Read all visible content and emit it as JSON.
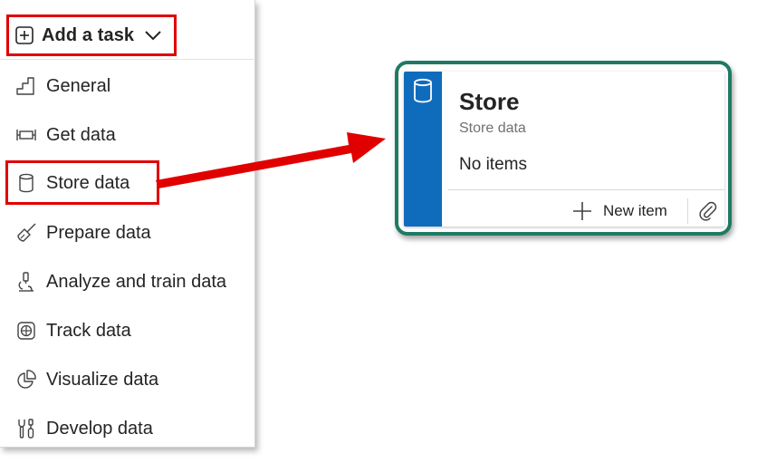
{
  "menu": {
    "add_task": {
      "label": "Add a task",
      "icon": "add-square-icon",
      "chevron": "chevron-down-icon"
    },
    "items": [
      {
        "label": "General",
        "icon": "stairs-icon"
      },
      {
        "label": "Get data",
        "icon": "get-data-icon"
      },
      {
        "label": "Store data",
        "icon": "database-icon"
      },
      {
        "label": "Prepare data",
        "icon": "broom-icon"
      },
      {
        "label": "Analyze and train data",
        "icon": "microscope-icon"
      },
      {
        "label": "Track data",
        "icon": "grid-globe-icon"
      },
      {
        "label": "Visualize data",
        "icon": "pie-chart-icon"
      },
      {
        "label": "Develop data",
        "icon": "wrench-screwdriver-icon"
      }
    ]
  },
  "card": {
    "title": "Store",
    "subtitle": "Store data",
    "empty_text": "No items",
    "new_item_label": "New item",
    "icon": "database-icon",
    "attach_icon": "paperclip-icon"
  },
  "colors": {
    "highlight_red": "#e00000",
    "card_border_green": "#1f7a63",
    "card_strip_blue": "#0f6cbd",
    "text_primary": "#242424",
    "text_secondary": "#707070"
  }
}
